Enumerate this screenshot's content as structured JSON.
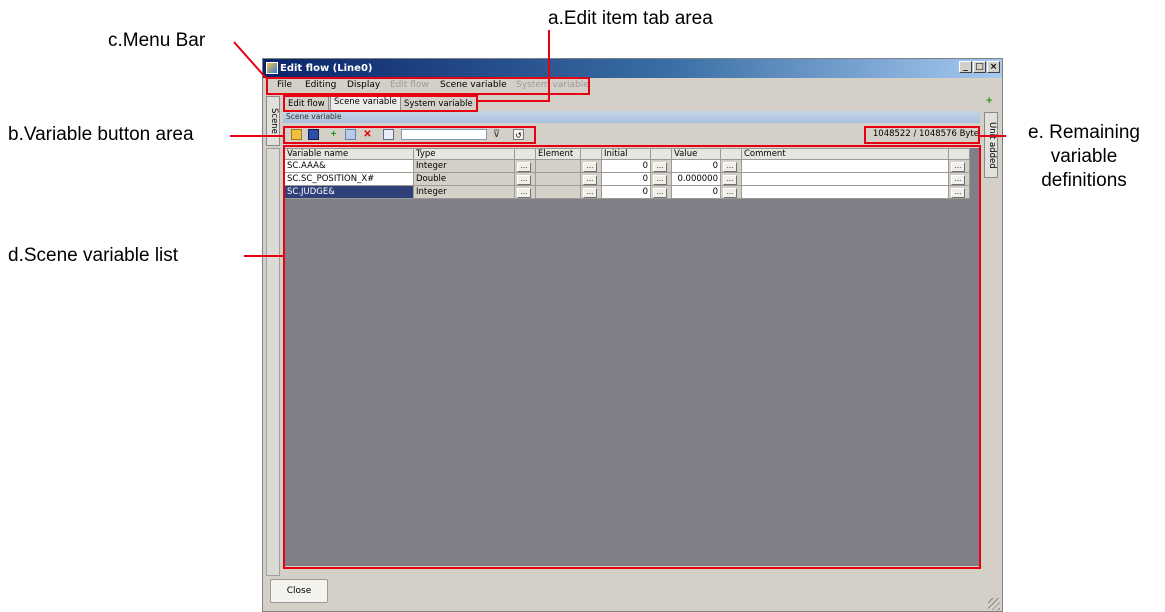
{
  "callouts": {
    "a": "a.Edit item tab area",
    "b": "b.Variable button area",
    "c": "c.Menu Bar",
    "d": "d.Scene variable list",
    "e_line1": "e. Remaining",
    "e_line2": "variable",
    "e_line3": "definitions"
  },
  "window": {
    "title": "Edit flow (Line0)",
    "buttons": {
      "minimize": "_",
      "maximize": "□",
      "close": "×"
    }
  },
  "menu": {
    "file": "File",
    "editing": "Editing",
    "display": "Display",
    "edit_flow": "Edit flow",
    "scene_variable": "Scene variable",
    "system_variable": "System variable"
  },
  "tabs": {
    "edit_flow": "Edit flow",
    "scene_variable": "Scene variable",
    "system_variable": "System variable"
  },
  "side_tabs": {
    "scene": "Scene",
    "right": "Unit added"
  },
  "group_label": "Scene variable",
  "toolbar_icons": [
    "open-folder-icon",
    "save-icon",
    "add-icon",
    "copy-icon",
    "delete-icon",
    "paste-icon",
    "filter-icon",
    "clear-filter-icon"
  ],
  "filter_value": "",
  "remaining": "1048522 / 1048576 Byte",
  "table": {
    "columns": {
      "variable_name": "Variable name",
      "type": "Type",
      "element": "Element",
      "initial": "Initial",
      "value": "Value",
      "comment": "Comment"
    },
    "ellipsis": "...",
    "rows": [
      {
        "name": "SC.AAA&",
        "type": "Integer",
        "initial": "0",
        "value": "0"
      },
      {
        "name": "SC.SC_POSITION_X#",
        "type": "Double",
        "initial": "0",
        "value": "0.000000"
      },
      {
        "name": "SC.JUDGE&",
        "type": "Integer",
        "initial": "0",
        "value": "0",
        "selected": true
      }
    ]
  },
  "close_label": "Close",
  "colors": {
    "highlight_red": "#e60012",
    "title_blue": "#0a246a",
    "selection": "#2f3f78",
    "list_bg": "#7f8087"
  }
}
